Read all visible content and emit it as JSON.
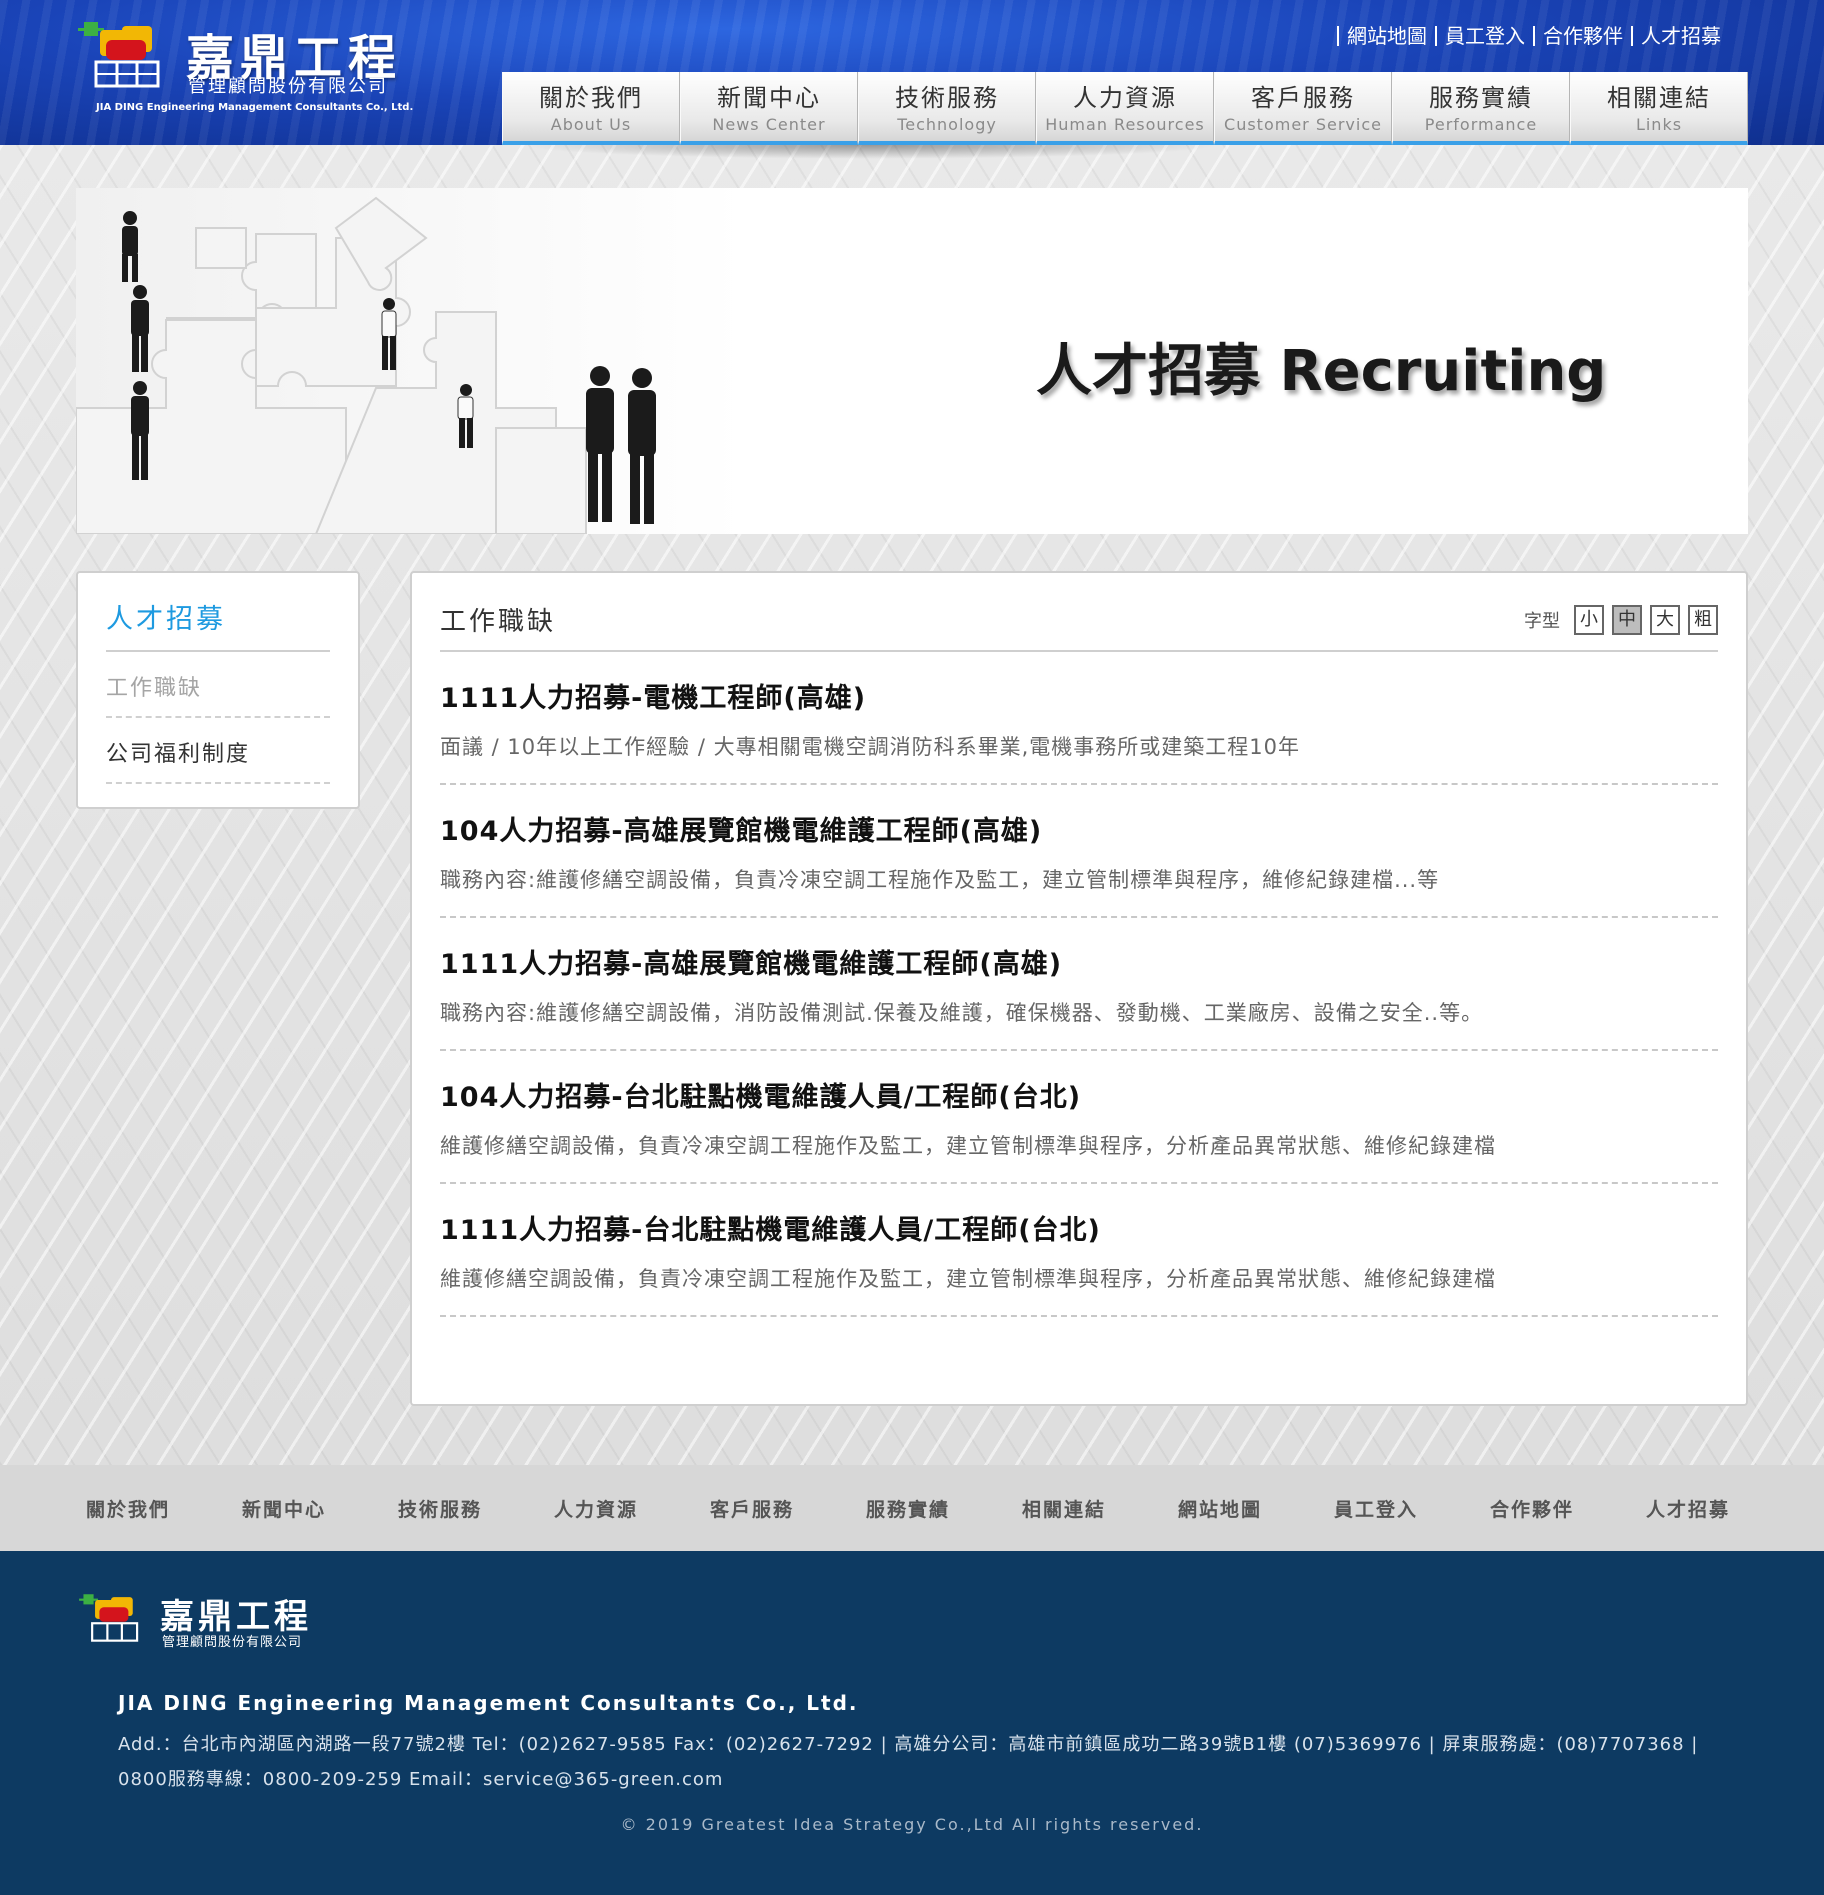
{
  "header": {
    "logo_title": "嘉鼎工程",
    "logo_subtitle": "管理顧問股份有限公司",
    "logo_english": "JIA DING Engineering Management Consultants Co., Ltd.",
    "top_links": [
      "網站地圖",
      "員工登入",
      "合作夥伴",
      "人才招募"
    ],
    "nav": [
      {
        "zh": "關於我們",
        "en": "About Us"
      },
      {
        "zh": "新聞中心",
        "en": "News Center"
      },
      {
        "zh": "技術服務",
        "en": "Technology"
      },
      {
        "zh": "人力資源",
        "en": "Human Resources"
      },
      {
        "zh": "客戶服務",
        "en": "Customer Service"
      },
      {
        "zh": "服務實績",
        "en": "Performance"
      },
      {
        "zh": "相關連結",
        "en": "Links"
      }
    ]
  },
  "banner": {
    "title": "人才招募  Recruiting"
  },
  "sidebar": {
    "title": "人才招募",
    "items": [
      "工作職缺",
      "公司福利制度"
    ]
  },
  "content": {
    "title": "工作職缺",
    "font_size_label": "字型",
    "font_size_options": [
      "小",
      "中",
      "大",
      "粗"
    ],
    "jobs": [
      {
        "title": "1111人力招募-電機工程師(高雄)",
        "desc": "面議 / 10年以上工作經驗 / 大專相關電機空調消防科系畢業,電機事務所或建築工程10年"
      },
      {
        "title": "104人力招募-高雄展覽館機電維護工程師(高雄)",
        "desc": "職務內容:維護修繕空調設備，負責冷凍空調工程施作及監工，建立管制標準與程序，維修紀錄建檔...等"
      },
      {
        "title": "1111人力招募-高雄展覽館機電維護工程師(高雄)",
        "desc": "職務內容:維護修繕空調設備，消防設備測試.保養及維護，確保機器、發動機、工業廠房、設備之安全..等。"
      },
      {
        "title": "104人力招募-台北駐點機電維護人員/工程師(台北)",
        "desc": "維護修繕空調設備，負責冷凍空調工程施作及監工，建立管制標準與程序，分析產品異常狀態、維修紀錄建檔"
      },
      {
        "title": "1111人力招募-台北駐點機電維護人員/工程師(台北)",
        "desc": "維護修繕空調設備，負責冷凍空調工程施作及監工，建立管制標準與程序，分析產品異常狀態、維修紀錄建檔"
      }
    ]
  },
  "footer_nav": [
    "關於我們",
    "新聞中心",
    "技術服務",
    "人力資源",
    "客戶服務",
    "服務實績",
    "相關連結",
    "網站地圖",
    "員工登入",
    "合作夥伴",
    "人才招募"
  ],
  "footer": {
    "logo_title": "嘉鼎工程",
    "logo_subtitle": "管理顧問股份有限公司",
    "company": "JIA DING Engineering Management Consultants Co., Ltd.",
    "address_line1": "Add.：台北市內湖區內湖路一段77號2樓 Tel：(02)2627-9585 Fax：(02)2627-7292 | 高雄分公司：高雄市前鎮區成功二路39號B1樓 (07)5369976 | 屏東服務處：(08)7707368 |",
    "address_line2": "0800服務專線：0800-209-259 Email：service@365-green.com",
    "copyright": "© 2019 Greatest Idea Strategy Co.,Ltd All rights reserved."
  },
  "colors": {
    "header_blue": "#1a44b8",
    "accent_blue": "#1e9ae0",
    "footer_navy": "#0d3a62"
  }
}
